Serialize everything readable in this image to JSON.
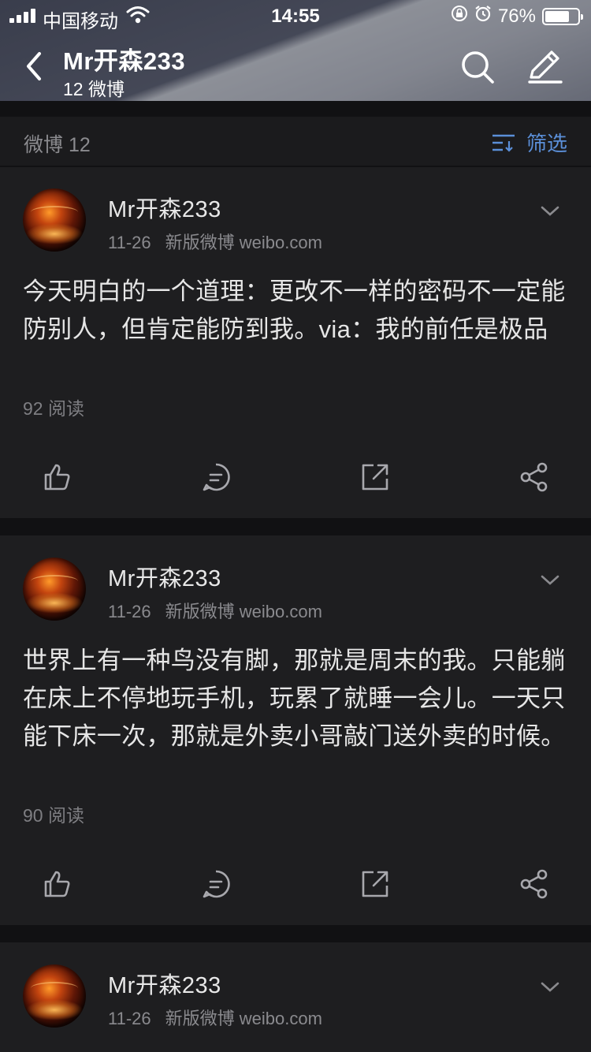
{
  "status_bar": {
    "carrier": "中国移动",
    "time": "14:55",
    "battery_text": "76%",
    "battery_level": 0.76,
    "icons": [
      "signal-icon",
      "wifi-icon",
      "rotation-lock-icon",
      "alarm-icon",
      "battery-icon"
    ]
  },
  "nav": {
    "title": "Mr开森233",
    "subtitle": "12 微博",
    "icons": [
      "back-icon",
      "search-icon",
      "edit-icon"
    ]
  },
  "filter": {
    "count_label": "微博 12",
    "filter_label": "筛选",
    "accent_color": "#5b8fd8"
  },
  "posts": [
    {
      "username": "Mr开森233",
      "date": "11-26",
      "source": "新版微博 weibo.com",
      "text": "今天明白的一个道理：更改不一样的密码不一定能防别人，但肯定能防到我。via：我的前任是极品",
      "reads": "92 阅读"
    },
    {
      "username": "Mr开森233",
      "date": "11-26",
      "source": "新版微博 weibo.com",
      "text": "世界上有一种鸟没有脚，那就是周末的我。只能躺在床上不停地玩手机，玩累了就睡一会儿。一天只能下床一次，那就是外卖小哥敲门送外卖的时候。",
      "reads": "90 阅读"
    },
    {
      "username": "Mr开森233",
      "date": "11-26",
      "source": "新版微博 weibo.com"
    }
  ],
  "action_icons": [
    "like-icon",
    "comment-icon",
    "repost-icon",
    "share-icon"
  ]
}
